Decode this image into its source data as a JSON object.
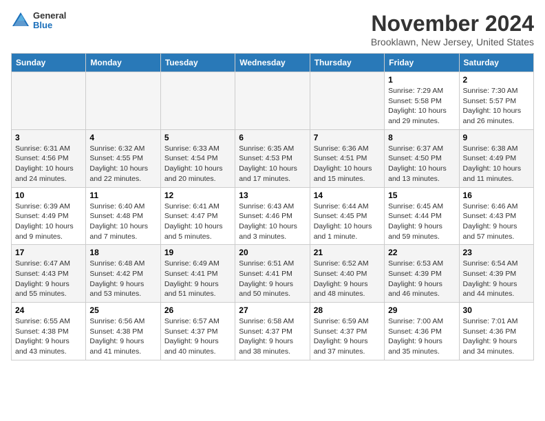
{
  "header": {
    "logo_general": "General",
    "logo_blue": "Blue",
    "title": "November 2024",
    "location": "Brooklawn, New Jersey, United States"
  },
  "days_of_week": [
    "Sunday",
    "Monday",
    "Tuesday",
    "Wednesday",
    "Thursday",
    "Friday",
    "Saturday"
  ],
  "weeks": [
    [
      {
        "day": "",
        "info": ""
      },
      {
        "day": "",
        "info": ""
      },
      {
        "day": "",
        "info": ""
      },
      {
        "day": "",
        "info": ""
      },
      {
        "day": "",
        "info": ""
      },
      {
        "day": "1",
        "info": "Sunrise: 7:29 AM\nSunset: 5:58 PM\nDaylight: 10 hours and 29 minutes."
      },
      {
        "day": "2",
        "info": "Sunrise: 7:30 AM\nSunset: 5:57 PM\nDaylight: 10 hours and 26 minutes."
      }
    ],
    [
      {
        "day": "3",
        "info": "Sunrise: 6:31 AM\nSunset: 4:56 PM\nDaylight: 10 hours and 24 minutes."
      },
      {
        "day": "4",
        "info": "Sunrise: 6:32 AM\nSunset: 4:55 PM\nDaylight: 10 hours and 22 minutes."
      },
      {
        "day": "5",
        "info": "Sunrise: 6:33 AM\nSunset: 4:54 PM\nDaylight: 10 hours and 20 minutes."
      },
      {
        "day": "6",
        "info": "Sunrise: 6:35 AM\nSunset: 4:53 PM\nDaylight: 10 hours and 17 minutes."
      },
      {
        "day": "7",
        "info": "Sunrise: 6:36 AM\nSunset: 4:51 PM\nDaylight: 10 hours and 15 minutes."
      },
      {
        "day": "8",
        "info": "Sunrise: 6:37 AM\nSunset: 4:50 PM\nDaylight: 10 hours and 13 minutes."
      },
      {
        "day": "9",
        "info": "Sunrise: 6:38 AM\nSunset: 4:49 PM\nDaylight: 10 hours and 11 minutes."
      }
    ],
    [
      {
        "day": "10",
        "info": "Sunrise: 6:39 AM\nSunset: 4:49 PM\nDaylight: 10 hours and 9 minutes."
      },
      {
        "day": "11",
        "info": "Sunrise: 6:40 AM\nSunset: 4:48 PM\nDaylight: 10 hours and 7 minutes."
      },
      {
        "day": "12",
        "info": "Sunrise: 6:41 AM\nSunset: 4:47 PM\nDaylight: 10 hours and 5 minutes."
      },
      {
        "day": "13",
        "info": "Sunrise: 6:43 AM\nSunset: 4:46 PM\nDaylight: 10 hours and 3 minutes."
      },
      {
        "day": "14",
        "info": "Sunrise: 6:44 AM\nSunset: 4:45 PM\nDaylight: 10 hours and 1 minute."
      },
      {
        "day": "15",
        "info": "Sunrise: 6:45 AM\nSunset: 4:44 PM\nDaylight: 9 hours and 59 minutes."
      },
      {
        "day": "16",
        "info": "Sunrise: 6:46 AM\nSunset: 4:43 PM\nDaylight: 9 hours and 57 minutes."
      }
    ],
    [
      {
        "day": "17",
        "info": "Sunrise: 6:47 AM\nSunset: 4:43 PM\nDaylight: 9 hours and 55 minutes."
      },
      {
        "day": "18",
        "info": "Sunrise: 6:48 AM\nSunset: 4:42 PM\nDaylight: 9 hours and 53 minutes."
      },
      {
        "day": "19",
        "info": "Sunrise: 6:49 AM\nSunset: 4:41 PM\nDaylight: 9 hours and 51 minutes."
      },
      {
        "day": "20",
        "info": "Sunrise: 6:51 AM\nSunset: 4:41 PM\nDaylight: 9 hours and 50 minutes."
      },
      {
        "day": "21",
        "info": "Sunrise: 6:52 AM\nSunset: 4:40 PM\nDaylight: 9 hours and 48 minutes."
      },
      {
        "day": "22",
        "info": "Sunrise: 6:53 AM\nSunset: 4:39 PM\nDaylight: 9 hours and 46 minutes."
      },
      {
        "day": "23",
        "info": "Sunrise: 6:54 AM\nSunset: 4:39 PM\nDaylight: 9 hours and 44 minutes."
      }
    ],
    [
      {
        "day": "24",
        "info": "Sunrise: 6:55 AM\nSunset: 4:38 PM\nDaylight: 9 hours and 43 minutes."
      },
      {
        "day": "25",
        "info": "Sunrise: 6:56 AM\nSunset: 4:38 PM\nDaylight: 9 hours and 41 minutes."
      },
      {
        "day": "26",
        "info": "Sunrise: 6:57 AM\nSunset: 4:37 PM\nDaylight: 9 hours and 40 minutes."
      },
      {
        "day": "27",
        "info": "Sunrise: 6:58 AM\nSunset: 4:37 PM\nDaylight: 9 hours and 38 minutes."
      },
      {
        "day": "28",
        "info": "Sunrise: 6:59 AM\nSunset: 4:37 PM\nDaylight: 9 hours and 37 minutes."
      },
      {
        "day": "29",
        "info": "Sunrise: 7:00 AM\nSunset: 4:36 PM\nDaylight: 9 hours and 35 minutes."
      },
      {
        "day": "30",
        "info": "Sunrise: 7:01 AM\nSunset: 4:36 PM\nDaylight: 9 hours and 34 minutes."
      }
    ]
  ]
}
